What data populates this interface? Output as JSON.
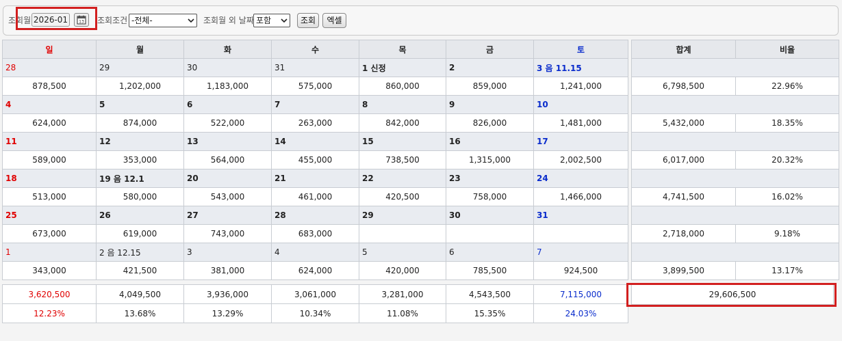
{
  "search": {
    "month_label": "조회월",
    "month_value": "2026-01",
    "condition_label": "조회조건",
    "condition_value": "-전체-",
    "outside_label": "조회월 외 날짜",
    "outside_value": "포함",
    "search_button": "조회",
    "excel_button": "엑셀"
  },
  "calendar": {
    "weekdays": [
      "일",
      "월",
      "화",
      "수",
      "목",
      "금",
      "토"
    ],
    "summary_headers": [
      "합계",
      "비율"
    ],
    "weeks": [
      {
        "days": [
          "28",
          "29",
          "30",
          "31",
          "1 신정",
          "2",
          "3 음 11.15"
        ],
        "amounts": [
          "878,500",
          "1,202,000",
          "1,183,000",
          "575,000",
          "860,000",
          "859,000",
          "1,241,000"
        ],
        "total": "6,798,500",
        "ratio": "22.96%"
      },
      {
        "days": [
          "4",
          "5",
          "6",
          "7",
          "8",
          "9",
          "10"
        ],
        "amounts": [
          "624,000",
          "874,000",
          "522,000",
          "263,000",
          "842,000",
          "826,000",
          "1,481,000"
        ],
        "total": "5,432,000",
        "ratio": "18.35%"
      },
      {
        "days": [
          "11",
          "12",
          "13",
          "14",
          "15",
          "16",
          "17"
        ],
        "amounts": [
          "589,000",
          "353,000",
          "564,000",
          "455,000",
          "738,500",
          "1,315,000",
          "2,002,500"
        ],
        "total": "6,017,000",
        "ratio": "20.32%"
      },
      {
        "days": [
          "18",
          "19 음 12.1",
          "20",
          "21",
          "22",
          "23",
          "24"
        ],
        "amounts": [
          "513,000",
          "580,000",
          "543,000",
          "461,000",
          "420,500",
          "758,000",
          "1,466,000"
        ],
        "total": "4,741,500",
        "ratio": "16.02%"
      },
      {
        "days": [
          "25",
          "26",
          "27",
          "28",
          "29",
          "30",
          "31"
        ],
        "amounts": [
          "673,000",
          "619,000",
          "743,000",
          "683,000",
          "",
          "",
          ""
        ],
        "total": "2,718,000",
        "ratio": "9.18%"
      },
      {
        "days": [
          "1",
          "2 음 12.15",
          "3",
          "4",
          "5",
          "6",
          "7"
        ],
        "amounts": [
          "343,000",
          "421,500",
          "381,000",
          "624,000",
          "420,000",
          "785,500",
          "924,500"
        ],
        "total": "3,899,500",
        "ratio": "13.17%"
      }
    ],
    "weekday_totals": [
      "3,620,500",
      "4,049,500",
      "3,936,000",
      "3,061,000",
      "3,281,000",
      "4,543,500",
      "7,115,000"
    ],
    "weekday_ratios": [
      "12.23%",
      "13.68%",
      "13.29%",
      "10.34%",
      "11.08%",
      "15.35%",
      "24.03%"
    ],
    "grand_total": "29,606,500"
  },
  "colors": {
    "sunday": "#e00000",
    "saturday": "#0a2ccc",
    "highlight": "#d21f1f"
  }
}
